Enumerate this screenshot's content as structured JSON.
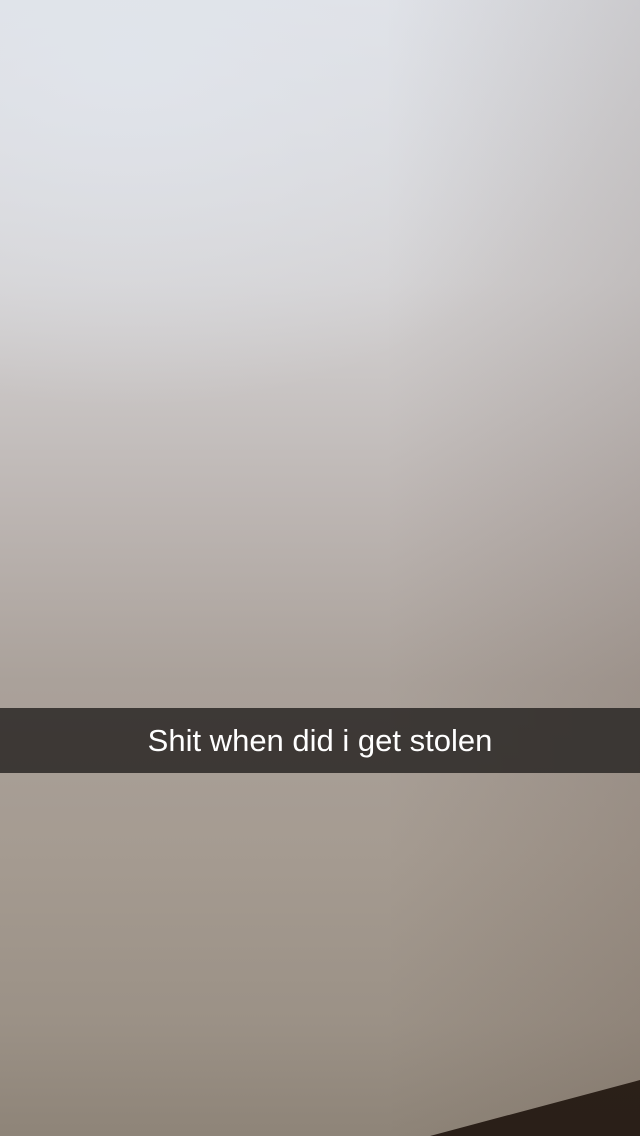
{
  "caption": {
    "text": "Shit when did i get stolen"
  },
  "colors": {
    "caption_bar": "#2d2a28",
    "caption_text": "#ffffff"
  }
}
